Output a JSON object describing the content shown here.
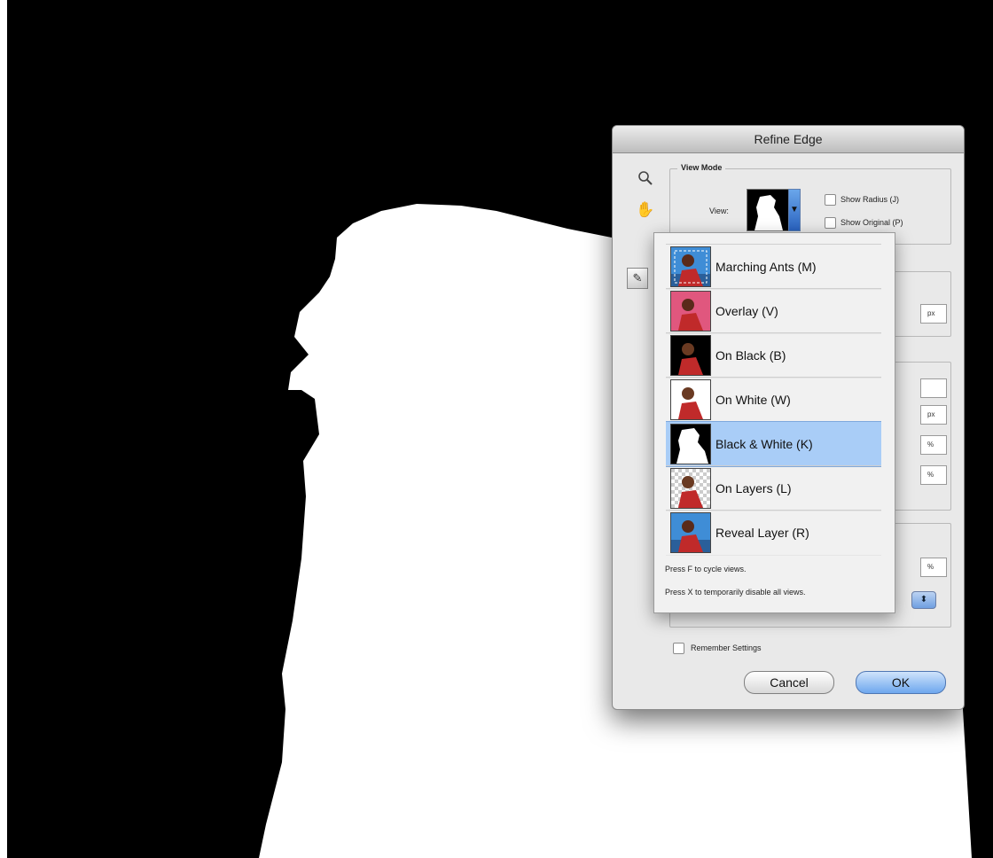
{
  "dialog": {
    "title": "Refine Edge",
    "view_mode_legend": "View Mode",
    "view_label": "View:",
    "show_radius": "Show Radius (J)",
    "show_original": "Show Original (P)",
    "remember_settings": "Remember Settings",
    "cancel": "Cancel",
    "ok": "OK",
    "units": {
      "px1": "px",
      "px2": "px",
      "pct1": "%",
      "pct2": "%",
      "pct3": "%"
    }
  },
  "menu": {
    "items": [
      {
        "label": "Marching Ants (M)",
        "thumb": "marching-ants"
      },
      {
        "label": "Overlay (V)",
        "thumb": "overlay"
      },
      {
        "label": "On Black (B)",
        "thumb": "on-black"
      },
      {
        "label": "On White (W)",
        "thumb": "on-white"
      },
      {
        "label": "Black & White (K)",
        "thumb": "black-white",
        "selected": true
      },
      {
        "label": "On Layers (L)",
        "thumb": "on-layers"
      },
      {
        "label": "Reveal Layer (R)",
        "thumb": "reveal-layer"
      }
    ],
    "note1": "Press F to cycle views.",
    "note2": "Press X to temporarily disable all views."
  },
  "icons": {
    "zoom": "magnifier-icon",
    "hand": "hand-icon",
    "brush": "refine-radius-brush-icon"
  }
}
